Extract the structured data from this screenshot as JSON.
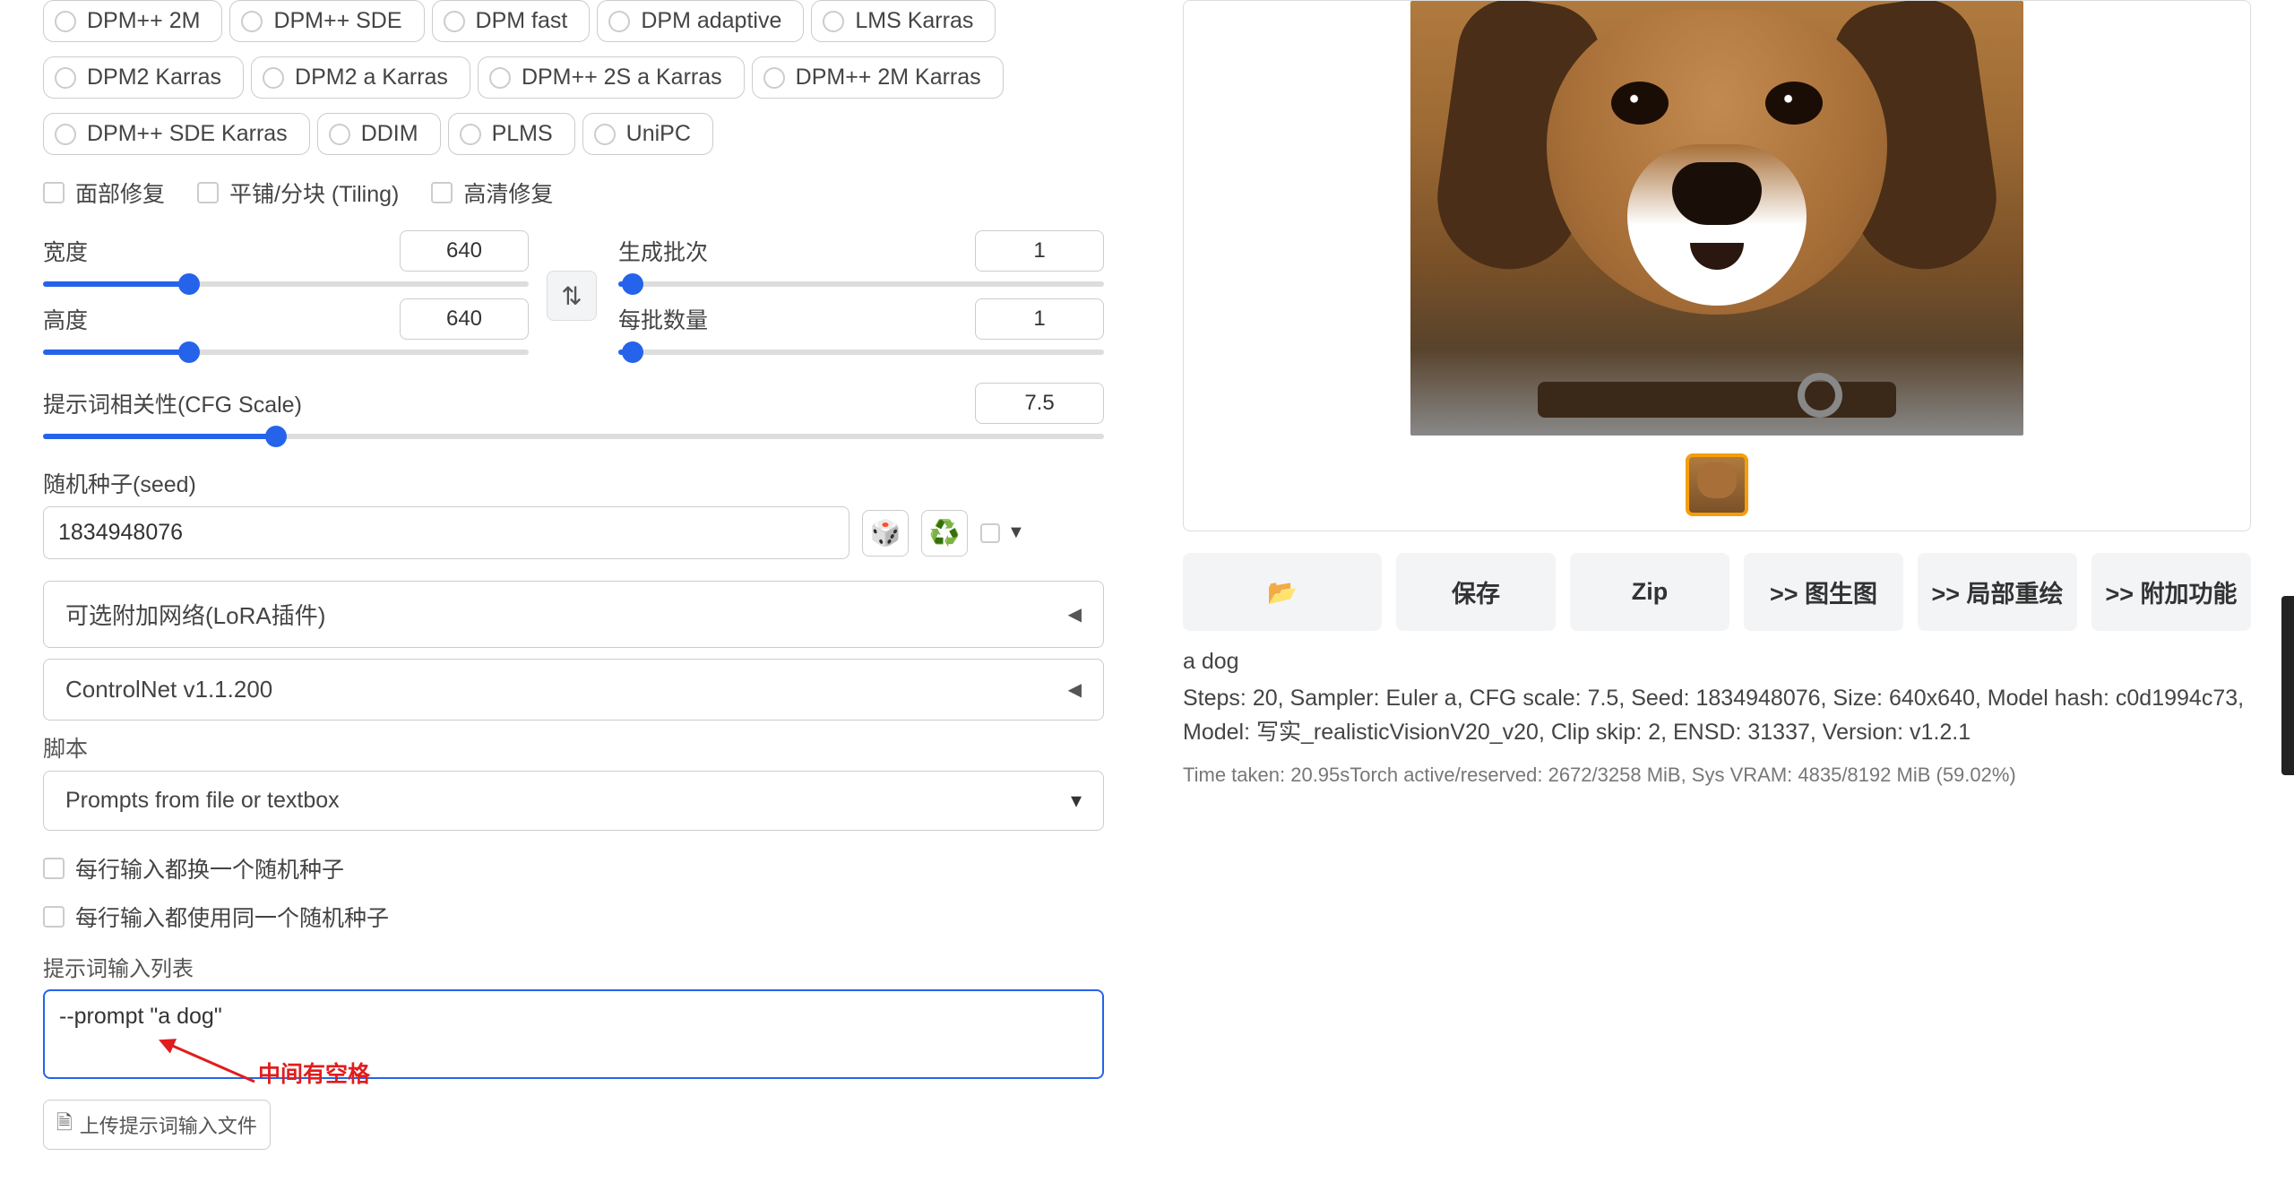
{
  "samplers": {
    "row1": [
      "DPM++ 2M",
      "DPM++ SDE",
      "DPM fast",
      "DPM adaptive",
      "LMS Karras"
    ],
    "row2": [
      "DPM2 Karras",
      "DPM2 a Karras",
      "DPM++ 2S a Karras",
      "DPM++ 2M Karras"
    ],
    "row3": [
      "DPM++ SDE Karras",
      "DDIM",
      "PLMS",
      "UniPC"
    ]
  },
  "checks": {
    "face": "面部修复",
    "tiling": "平铺/分块 (Tiling)",
    "hires": "高清修复"
  },
  "dims": {
    "width_label": "宽度",
    "width": "640",
    "height_label": "高度",
    "height": "640",
    "batch_count_label": "生成批次",
    "batch_count": "1",
    "batch_size_label": "每批数量",
    "batch_size": "1"
  },
  "cfg": {
    "label": "提示词相关性(CFG Scale)",
    "value": "7.5"
  },
  "seed": {
    "label": "随机种子(seed)",
    "value": "1834948076"
  },
  "accordions": {
    "lora": "可选附加网络(LoRA插件)",
    "controlnet": "ControlNet v1.1.200"
  },
  "script": {
    "label": "脚本",
    "value": "Prompts from file or textbox"
  },
  "script_opts": {
    "iterate_seed": "每行输入都换一个随机种子",
    "same_seed": "每行输入都使用同一个随机种子",
    "prompt_list_label": "提示词输入列表",
    "textarea_value": "--prompt \"a dog\"",
    "annotation": "中间有空格",
    "upload": "上传提示词输入文件"
  },
  "actions": {
    "folder_icon": "📂",
    "save": "保存",
    "zip": "Zip",
    "img2img": ">> 图生图",
    "inpaint": ">> 局部重绘",
    "extras": ">> 附加功能"
  },
  "result": {
    "prompt": "a dog",
    "meta": "Steps: 20, Sampler: Euler a, CFG scale: 7.5, Seed: 1834948076, Size: 640x640, Model hash: c0d1994c73, Model: 写实_realisticVisionV20_v20, Clip skip: 2, ENSD: 31337, Version: v1.2.1",
    "timing": "Time taken: 20.95sTorch active/reserved: 2672/3258 MiB, Sys VRAM: 4835/8192 MiB (59.02%)"
  }
}
